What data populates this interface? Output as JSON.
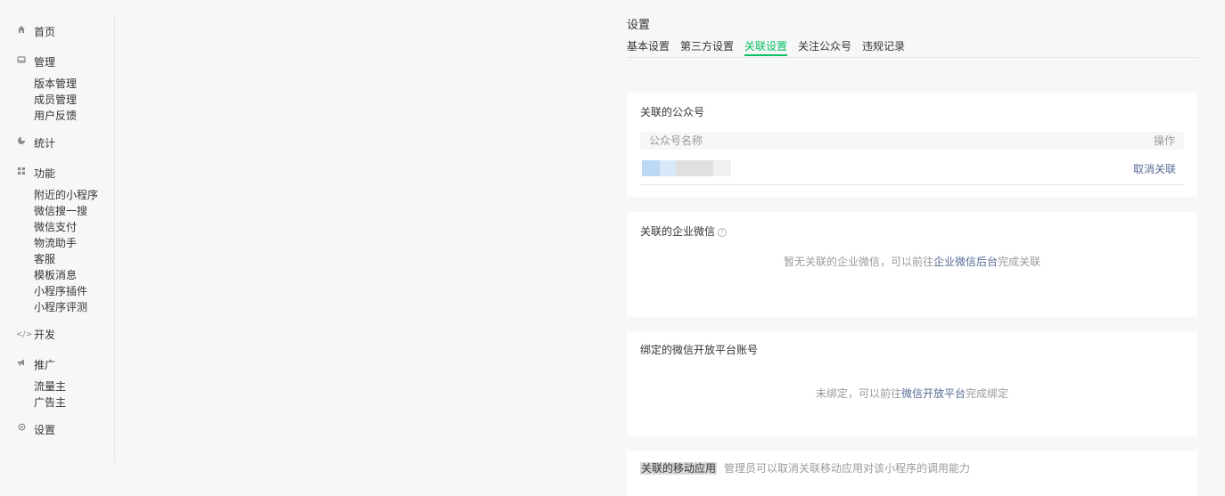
{
  "sidebar": {
    "home": {
      "label": "首页",
      "icon": "home-icon"
    },
    "manage": {
      "label": "管理",
      "icon": "inbox-icon",
      "items": [
        "版本管理",
        "成员管理",
        "用户反馈"
      ]
    },
    "stats": {
      "label": "统计",
      "icon": "pie-chart-icon"
    },
    "features": {
      "label": "功能",
      "icon": "grid-icon",
      "items": [
        "附近的小程序",
        "微信搜一搜",
        "微信支付",
        "物流助手",
        "客服",
        "模板消息",
        "小程序插件",
        "小程序评测"
      ]
    },
    "dev": {
      "label": "开发",
      "icon": "code-icon"
    },
    "promo": {
      "label": "推广",
      "icon": "megaphone-icon",
      "items": [
        "流量主",
        "广告主"
      ]
    },
    "settings": {
      "label": "设置",
      "icon": "gear-icon"
    }
  },
  "main": {
    "title": "设置",
    "tabs": [
      "基本设置",
      "第三方设置",
      "关联设置",
      "关注公众号",
      "违规记录"
    ],
    "active_tab": "关联设置",
    "accent_color": "#07c160",
    "link_color": "#576b95",
    "official_accounts": {
      "title": "关联的公众号",
      "columns": [
        "公众号名称",
        "操作"
      ],
      "row_action": "取消关联"
    },
    "wecom": {
      "title": "关联的企业微信",
      "empty_prefix": "暂无关联的企业微信，可以前往",
      "empty_link": "企业微信后台",
      "empty_suffix": "完成关联"
    },
    "open_platform": {
      "title": "绑定的微信开放平台账号",
      "empty_prefix": "未绑定，可以前往",
      "empty_link": "微信开放平台",
      "empty_suffix": "完成绑定"
    },
    "mobile_app": {
      "title": "关联的移动应用",
      "description": "管理员可以取消关联移动应用对该小程序的调用能力"
    }
  }
}
